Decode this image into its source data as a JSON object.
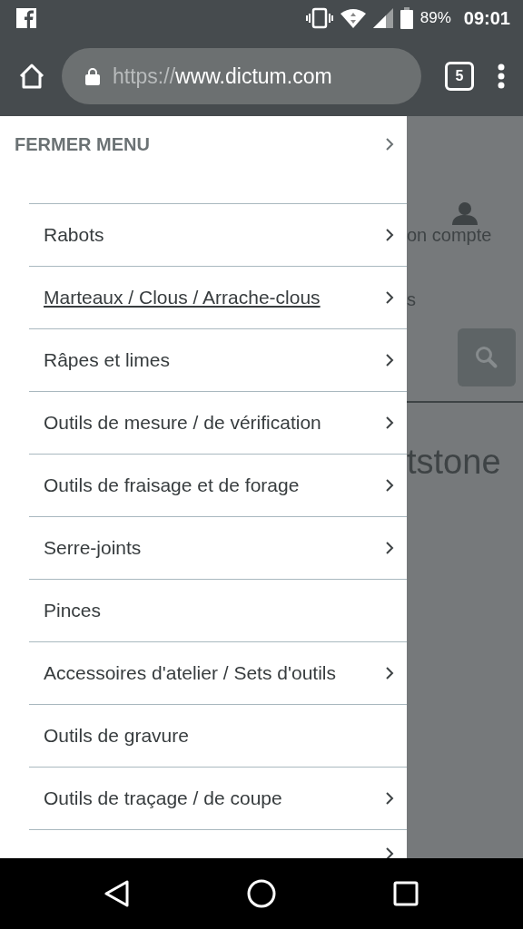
{
  "status_bar": {
    "battery": "89%",
    "time": "09:01"
  },
  "browser": {
    "url_scheme": "https://",
    "url_host": "www.dictum.com",
    "tab_count": "5"
  },
  "menu": {
    "close_label": "FERMER MENU",
    "items": [
      {
        "label": "Rabots",
        "has_children": true,
        "underlined": false
      },
      {
        "label": "Marteaux / Clous / Arrache-clous",
        "has_children": true,
        "underlined": true
      },
      {
        "label": "Râpes et limes",
        "has_children": true,
        "underlined": false
      },
      {
        "label": "Outils de mesure / de vérification",
        "has_children": true,
        "underlined": false
      },
      {
        "label": "Outils de fraisage et de forage",
        "has_children": true,
        "underlined": false
      },
      {
        "label": "Serre-joints",
        "has_children": true,
        "underlined": false
      },
      {
        "label": "Pinces",
        "has_children": false,
        "underlined": false
      },
      {
        "label": "Accessoires d'atelier / Sets d'outils",
        "has_children": true,
        "underlined": false
      },
      {
        "label": "Outils de gravure",
        "has_children": false,
        "underlined": false
      },
      {
        "label": "Outils de traçage / de coupe",
        "has_children": true,
        "underlined": false
      }
    ],
    "cut_off_row": {
      "has_children": true
    }
  },
  "background_page": {
    "account_label": "on compte",
    "nav_fragment": "s",
    "heading_fragment": "tstone"
  }
}
